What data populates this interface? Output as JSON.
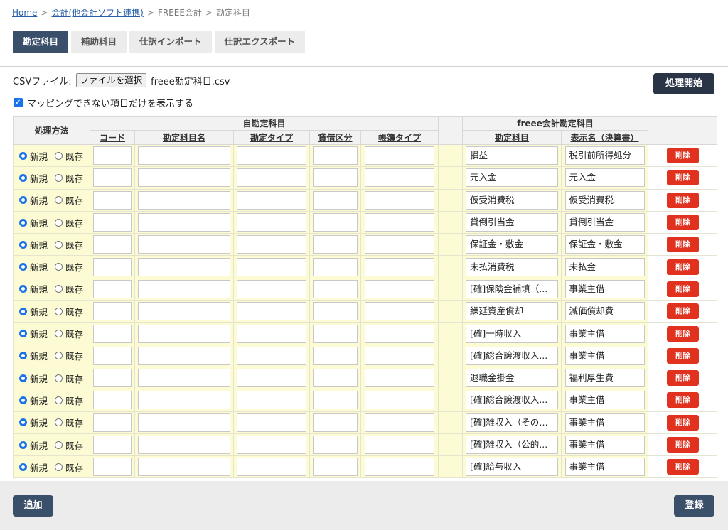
{
  "breadcrumb": {
    "home": "Home",
    "separator": ">",
    "accounting_link": "会計(他会計ソフト連携)",
    "freee": "FREEE会計",
    "current": "勘定科目"
  },
  "tabs": [
    {
      "label": "勘定科目",
      "active": true
    },
    {
      "label": "補助科目",
      "active": false
    },
    {
      "label": "仕訳インポート",
      "active": false
    },
    {
      "label": "仕訳エクスポート",
      "active": false
    }
  ],
  "csv": {
    "label": "CSVファイル:",
    "choose_button": "ファイルを選択",
    "filename": "freee勘定科目.csv"
  },
  "start_button": "処理開始",
  "filter_checkbox": {
    "label": "マッピングできない項目だけを表示する",
    "checked": true
  },
  "table": {
    "group_own": "自勘定科目",
    "group_freee": "freee会計勘定科目",
    "headers": {
      "method": "処理方法",
      "code": "コード",
      "name": "勘定科目名",
      "type": "勘定タイプ",
      "debit_credit": "貸借区分",
      "book_type": "帳簿タイプ",
      "freee_account": "勘定科目",
      "display_name": "表示名（決算書）"
    },
    "radio_new": "新規",
    "radio_existing": "既存",
    "delete_label": "削除",
    "rows": [
      {
        "freee_account": "損益",
        "display_name": "税引前所得処分"
      },
      {
        "freee_account": "元入金",
        "display_name": "元入金"
      },
      {
        "freee_account": "仮受消費税",
        "display_name": "仮受消費税"
      },
      {
        "freee_account": "貸倒引当金",
        "display_name": "貸倒引当金"
      },
      {
        "freee_account": "保証金・敷金",
        "display_name": "保証金・敷金"
      },
      {
        "freee_account": "未払消費税",
        "display_name": "未払金"
      },
      {
        "freee_account": "[確]保険金補填（...",
        "display_name": "事業主借"
      },
      {
        "freee_account": "繰延資産償却",
        "display_name": "減価償却費"
      },
      {
        "freee_account": "[確]一時収入",
        "display_name": "事業主借"
      },
      {
        "freee_account": "[確]総合譲渡収入...",
        "display_name": "事業主借"
      },
      {
        "freee_account": "退職金掛金",
        "display_name": "福利厚生費"
      },
      {
        "freee_account": "[確]総合譲渡収入...",
        "display_name": "事業主借"
      },
      {
        "freee_account": "[確]雑収入（その他）",
        "display_name": "事業主借"
      },
      {
        "freee_account": "[確]雑収入（公的...",
        "display_name": "事業主借"
      },
      {
        "freee_account": "[確]給与収入",
        "display_name": "事業主借"
      }
    ]
  },
  "footer": {
    "add_button": "追加",
    "register_button": "登録"
  },
  "colors": {
    "accent_dark": "#2a3447",
    "tab_active": "#3a4f6a",
    "delete": "#e0321f",
    "row_highlight": "#fdfbd3"
  }
}
